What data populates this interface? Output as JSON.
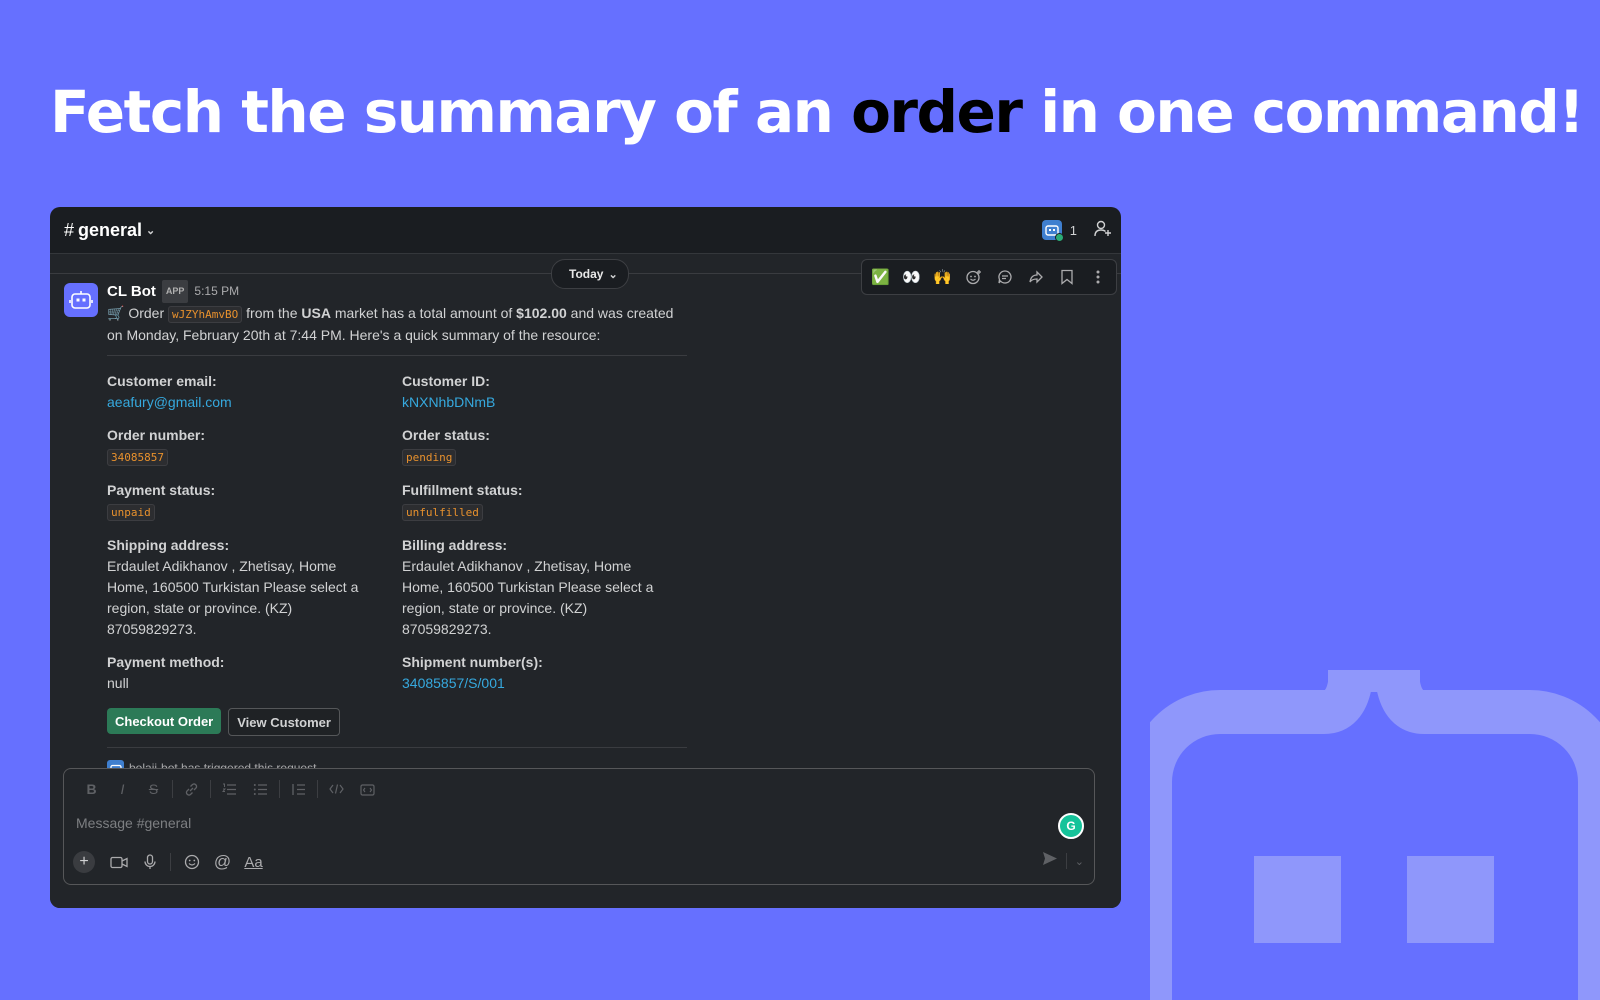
{
  "headline": {
    "part1": "Fetch the summary of an ",
    "emphasis": "order",
    "part2": " in one command!"
  },
  "channel": {
    "hash": "#",
    "name": "general",
    "member_count": "1"
  },
  "date_divider": "Today",
  "toolbar": {
    "reactions": [
      "✅",
      "👀",
      "🙌"
    ]
  },
  "message": {
    "sender": "CL Bot",
    "app_badge": "APP",
    "time": "5:15 PM",
    "intro": {
      "emoji": "🛒",
      "t1": " Order ",
      "order_id": "wJZYhAmvBO",
      "t2": " from the ",
      "market": "USA",
      "t3": " market has a total amount of ",
      "amount": "$102.00",
      "t4": " and was created on Monday, February 20th at 7:44 PM. Here's a quick summary of the resource:"
    },
    "fields": {
      "customer_email_label": "Customer email:",
      "customer_email": "aeafury@gmail.com",
      "customer_id_label": "Customer ID:",
      "customer_id": "kNXNhbDNmB",
      "order_number_label": "Order number:",
      "order_number": "34085857",
      "order_status_label": "Order status:",
      "order_status": "pending",
      "payment_status_label": "Payment status:",
      "payment_status": "unpaid",
      "fulfillment_status_label": "Fulfillment status:",
      "fulfillment_status": "unfulfilled",
      "shipping_address_label": "Shipping address:",
      "shipping_address": "Erdaulet Adikhanov , Zhetisay, Home Home, 160500 Turkistan Please select a region, state or province. (KZ) 87059829273.",
      "billing_address_label": "Billing address:",
      "billing_address": "Erdaulet Adikhanov , Zhetisay, Home Home, 160500 Turkistan Please select a region, state or province. (KZ) 87059829273.",
      "payment_method_label": "Payment method:",
      "payment_method": "null",
      "shipment_numbers_label": "Shipment number(s):",
      "shipment_numbers": "34085857/S/001"
    },
    "buttons": {
      "checkout": "Checkout Order",
      "view_customer": "View Customer"
    },
    "context": "bolaji-bot has triggered this request."
  },
  "composer": {
    "placeholder": "Message #general",
    "grammarly": "G",
    "text_format": "Aa"
  },
  "colors": {
    "background": "#6670ff",
    "window": "#1a1d21",
    "link": "#36a9de",
    "primary_button": "#2c7a57",
    "code": "#e8912d"
  }
}
